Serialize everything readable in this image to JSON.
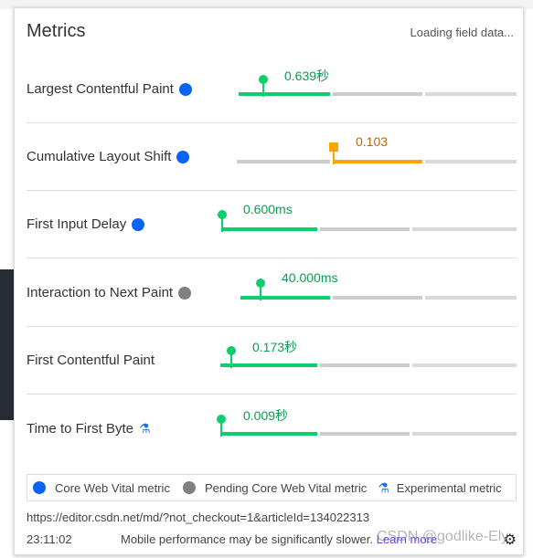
{
  "header": {
    "title": "Metrics",
    "status": "Loading field data..."
  },
  "metrics": [
    {
      "name": "Largest Contentful Paint",
      "badge": "core",
      "value": "0.639秒",
      "rating": "good"
    },
    {
      "name": "Cumulative Layout Shift",
      "badge": "core",
      "value": "0.103",
      "rating": "needs-improvement"
    },
    {
      "name": "First Input Delay",
      "badge": "core",
      "value": "0.600ms",
      "rating": "good"
    },
    {
      "name": "Interaction to Next Paint",
      "badge": "pending",
      "value": "40.000ms",
      "rating": "good"
    },
    {
      "name": "First Contentful Paint",
      "badge": "none",
      "value": "0.173秒",
      "rating": "good"
    },
    {
      "name": "Time to First Byte",
      "badge": "experimental",
      "value": "0.009秒",
      "rating": "good"
    }
  ],
  "legend": {
    "core": "Core Web Vital metric",
    "pending": "Pending Core Web Vital metric",
    "experimental": "Experimental metric"
  },
  "footer": {
    "url": "https://editor.csdn.net/md/?not_checkout=1&articleId=134022313",
    "time": "23:11:02",
    "mobile_note": "Mobile performance may be significantly slower.",
    "learn_more": "Learn more"
  },
  "watermark": "CSDN @godlike-Ely",
  "colors": {
    "good": "#0cce6b",
    "needs_improvement": "#ffa400",
    "core": "#0b63f6",
    "pending": "#808080"
  }
}
